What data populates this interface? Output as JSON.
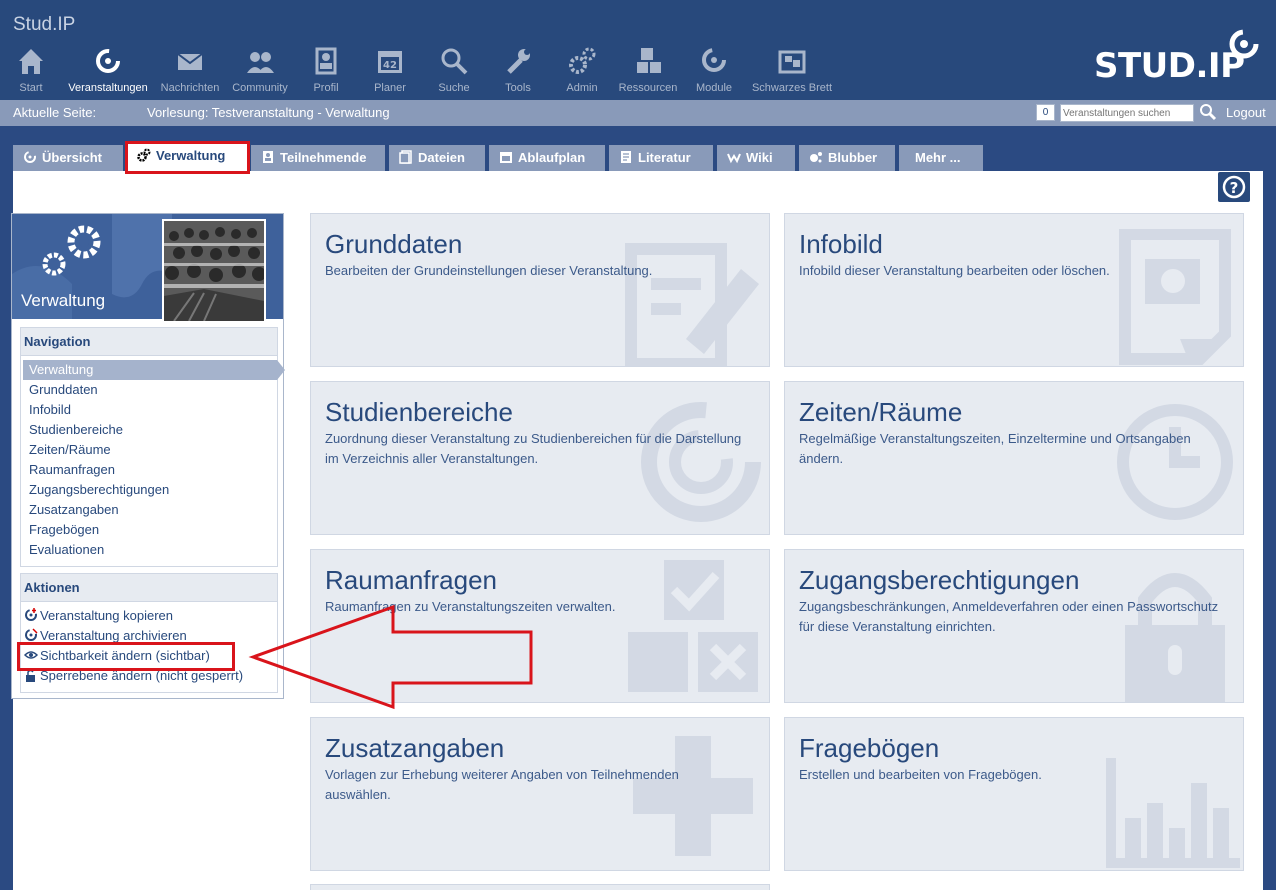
{
  "app": {
    "title": "Stud.IP",
    "logo_text": "STUD.IP"
  },
  "nav": [
    {
      "key": "start",
      "label": "Start"
    },
    {
      "key": "courses",
      "label": "Veranstaltungen"
    },
    {
      "key": "messages",
      "label": "Nachrichten"
    },
    {
      "key": "community",
      "label": "Community"
    },
    {
      "key": "profile",
      "label": "Profil"
    },
    {
      "key": "planner",
      "label": "Planer"
    },
    {
      "key": "search",
      "label": "Suche"
    },
    {
      "key": "tools",
      "label": "Tools"
    },
    {
      "key": "admin",
      "label": "Admin"
    },
    {
      "key": "resources",
      "label": "Ressourcen"
    },
    {
      "key": "modules",
      "label": "Module"
    },
    {
      "key": "board",
      "label": "Schwarzes Brett"
    }
  ],
  "breadcrumb": {
    "label": "Aktuelle Seite:",
    "path": "Vorlesung: Testveranstaltung - Verwaltung",
    "count": "0",
    "search_placeholder": "Veranstaltungen suchen",
    "logout": "Logout"
  },
  "tabs": [
    {
      "label": "Übersicht"
    },
    {
      "label": "Verwaltung",
      "active": true
    },
    {
      "label": "Teilnehmende"
    },
    {
      "label": "Dateien"
    },
    {
      "label": "Ablaufplan"
    },
    {
      "label": "Literatur"
    },
    {
      "label": "Wiki"
    },
    {
      "label": "Blubber"
    },
    {
      "label": "Mehr ..."
    }
  ],
  "sidebar": {
    "title": "Verwaltung",
    "navigation_heading": "Navigation",
    "navigation": [
      "Verwaltung",
      "Grunddaten",
      "Infobild",
      "Studienbereiche",
      "Zeiten/Räume",
      "Raumanfragen",
      "Zugangsberechtigungen",
      "Zusatzangaben",
      "Fragebögen",
      "Evaluationen"
    ],
    "actions_heading": "Aktionen",
    "actions": [
      "Veranstaltung kopieren",
      "Veranstaltung archivieren",
      "Sichtbarkeit ändern (sichtbar)",
      "Sperrebene ändern (nicht gesperrt)"
    ]
  },
  "tiles": [
    {
      "title": "Grunddaten",
      "desc": "Bearbeiten der Grundeinstellungen dieser Veranstaltung.",
      "icon": "edit-icon"
    },
    {
      "title": "Infobild",
      "desc": "Infobild dieser Veranstaltung bearbeiten oder löschen.",
      "icon": "picture-icon"
    },
    {
      "title": "Studienbereiche",
      "desc": "Zuordnung dieser Veranstaltung zu Studienbereichen für die Darstellung im Verzeichnis aller Veranstaltungen.",
      "icon": "seminar-icon"
    },
    {
      "title": "Zeiten/Räume",
      "desc": "Regelmäßige Veranstaltungszeiten, Einzeltermine und Ortsangaben ändern.",
      "icon": "clock-icon"
    },
    {
      "title": "Raumanfragen",
      "desc": "Raumanfragen zu Veranstaltungszeiten verwalten.",
      "icon": "resources-icon"
    },
    {
      "title": "Zugangsberechtigungen",
      "desc": "Zugangsbeschränkungen, Anmeldeverfahren oder einen Passwortschutz für diese Veranstaltung einrichten.",
      "icon": "lock-icon"
    },
    {
      "title": "Zusatzangaben",
      "desc": "Vorlagen zur Erhebung weiterer Angaben von Teilnehmenden auswählen.",
      "icon": "plus-icon"
    },
    {
      "title": "Fragebögen",
      "desc": "Erstellen und bearbeiten von Fragebögen.",
      "icon": "chart-icon"
    }
  ],
  "colors": {
    "header": "#28497c",
    "accent_red": "#d9141b",
    "tile_bg": "#e7ebf1"
  }
}
